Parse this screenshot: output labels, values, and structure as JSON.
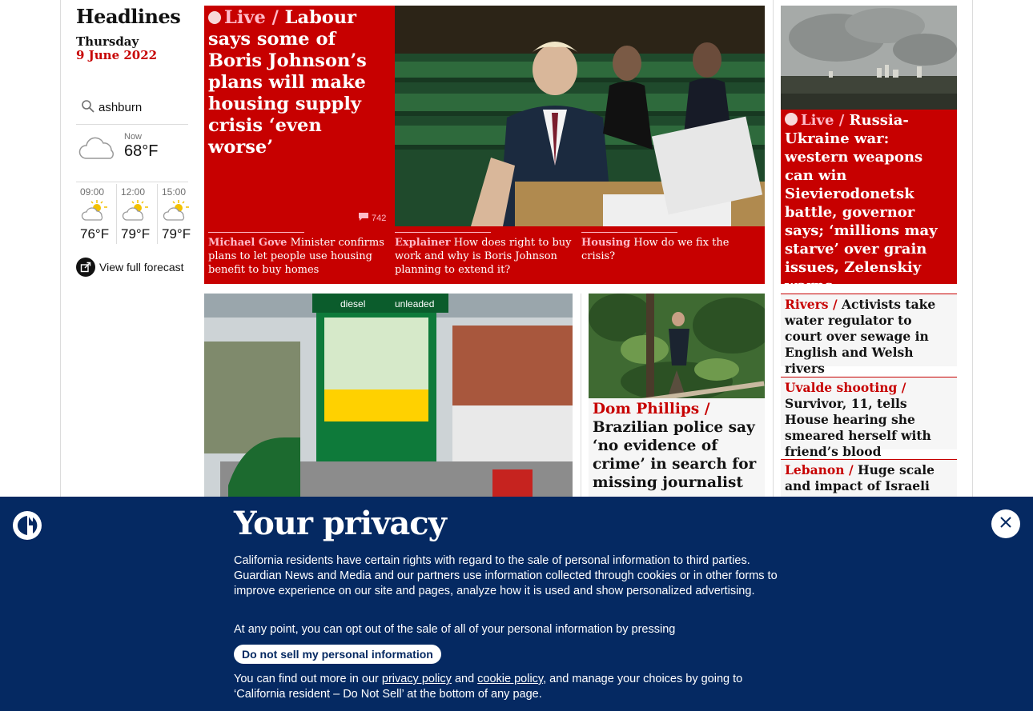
{
  "sidebar": {
    "section_title": "Headlines",
    "day": "Thursday",
    "date": "9 June 2022",
    "weather": {
      "location": "ashburn",
      "now_label": "Now",
      "now_temp": "68°F",
      "now_icon": "cloud-icon",
      "forecast": [
        {
          "time": "09:00",
          "temp": "76°F",
          "icon": "partly-sunny-icon"
        },
        {
          "time": "12:00",
          "temp": "79°F",
          "icon": "partly-sunny-icon"
        },
        {
          "time": "15:00",
          "temp": "79°F",
          "icon": "partly-sunny-icon"
        }
      ],
      "full_forecast_label": "View full forecast"
    }
  },
  "lead_story": {
    "live_label": "Live",
    "separator": "/",
    "headline": "Labour says some of Boris Johnson’s plans will make housing supply crisis ‘even worse’",
    "comment_count": "742",
    "sublinks": [
      {
        "kicker": "Michael Gove",
        "text": "Minister confirms plans to let people use housing benefit to buy homes"
      },
      {
        "kicker": "Explainer",
        "text": "How does right to buy work and why is Boris Johnson planning to extend it?"
      },
      {
        "kicker": "Housing",
        "text": "How do we fix the crisis?"
      }
    ]
  },
  "live_side": {
    "live_label": "Live",
    "separator": "/",
    "headline": "Russia-Ukraine war: western weapons can win Sievierodonetsk battle, governor says; ‘millions may starve’ over grain issues, Zelenskiy warns"
  },
  "dom_story": {
    "kicker": "Dom Phillips",
    "separator": "/",
    "headline": "Brazilian police say ‘no evidence of crime’ in search for missing journalist"
  },
  "side_cards": [
    {
      "kicker": "Rivers",
      "separator": "/",
      "headline": "Activists take water regulator to court over sewage in English and Welsh rivers"
    },
    {
      "kicker": "Uvalde shooting",
      "separator": "/",
      "headline": "Survivor, 11, tells House hearing she smeared herself with friend’s blood"
    },
    {
      "kicker": "Lebanon",
      "separator": "/",
      "headline": "Huge scale and impact of Israeli incursions revealed"
    }
  ],
  "petrol_photo": {
    "sign_left": "diesel",
    "sign_right": "unleaded"
  },
  "privacy": {
    "title": "Your privacy",
    "para1": "California residents have certain rights with regard to the sale of personal information to third parties. Guardian News and Media and our partners use information collected through cookies or in other forms to improve experience on our site and pages, analyze how it is used and show personalized advertising.",
    "para2": "At any point, you can opt out of the sale of all of your personal information by pressing",
    "button": "Do not sell my personal information",
    "para3_prefix": "You can find out more in our",
    "privacy_link": "privacy policy",
    "and": "and",
    "cookie_link": "cookie policy",
    "para3_suffix": ", and manage your choices by going to ‘California resident – Do Not Sell’ at the bottom of any page."
  },
  "colors": {
    "news_red": "#c70000",
    "privacy_blue": "#052962",
    "kicker_pink": "#ffbac8"
  }
}
